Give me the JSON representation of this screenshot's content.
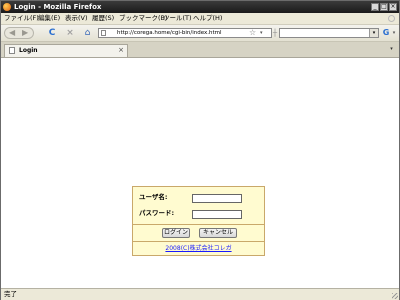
{
  "window": {
    "title": "Login - Mozilla Firefox",
    "buttons": {
      "minimize": "_",
      "maximize": "□",
      "close": "×"
    }
  },
  "menu": {
    "items": [
      "ファイル(F)",
      "編集(E)",
      "表示(V)",
      "履歴(S)",
      "ブックマーク(B)",
      "ツール(T)",
      "ヘルプ(H)"
    ]
  },
  "nav": {
    "back_icon": "back-arrow-icon",
    "forward_icon": "forward-arrow-icon",
    "reload_symbol": "C",
    "stop_symbol": "×",
    "home_symbol": "⌂",
    "url": "http://corega.home/cgi-bin/index.html",
    "star_symbol": "☆",
    "dropdown_symbol": "▾",
    "search_value": "",
    "search_engine_symbol": "G"
  },
  "tabs": [
    {
      "label": "Login",
      "close": "×"
    }
  ],
  "login_form": {
    "username_label": "ユーザ名:",
    "username_value": "",
    "password_label": "パスワード:",
    "password_value": "",
    "login_button": "ログイン",
    "cancel_button": "キャンセル",
    "copyright": "2008(C)株式会社コレガ"
  },
  "status": {
    "text": "完了"
  },
  "colors": {
    "form_background": "#fffbd0",
    "form_border": "#c9a86a",
    "link": "#1a1aff"
  }
}
